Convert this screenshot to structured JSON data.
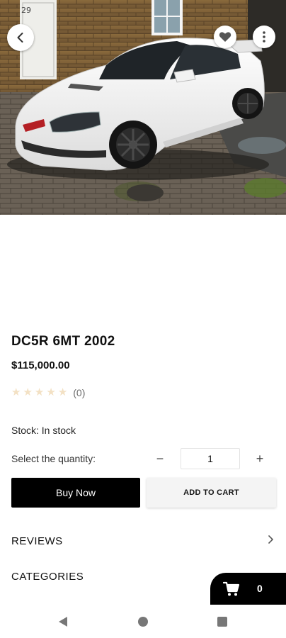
{
  "product": {
    "title": "DC5R 6MT 2002",
    "price": "$115,000.00",
    "rating_count": "(0)",
    "rating_value": 0,
    "rating_max": 5,
    "stock_text": "Stock: In stock"
  },
  "quantity": {
    "label": "Select the quantity:",
    "value": "1",
    "minus_symbol": "−",
    "plus_symbol": "+"
  },
  "actions": {
    "buy_now": "Buy Now",
    "add_to_cart": "ADD TO CART"
  },
  "sections": {
    "reviews": "REVIEWS",
    "categories": "CATEGORIES"
  },
  "cart": {
    "count": "0"
  },
  "icons": {
    "back": "arrow-left-icon",
    "favorite": "heart-icon",
    "more": "more-vertical-icon",
    "chevron": "chevron-right-icon",
    "cart": "shopping-cart-icon",
    "star": "star-icon"
  },
  "colors": {
    "primary": "#000000",
    "star_empty": "#f3e1c4",
    "secondary_button": "#f4f4f4"
  }
}
